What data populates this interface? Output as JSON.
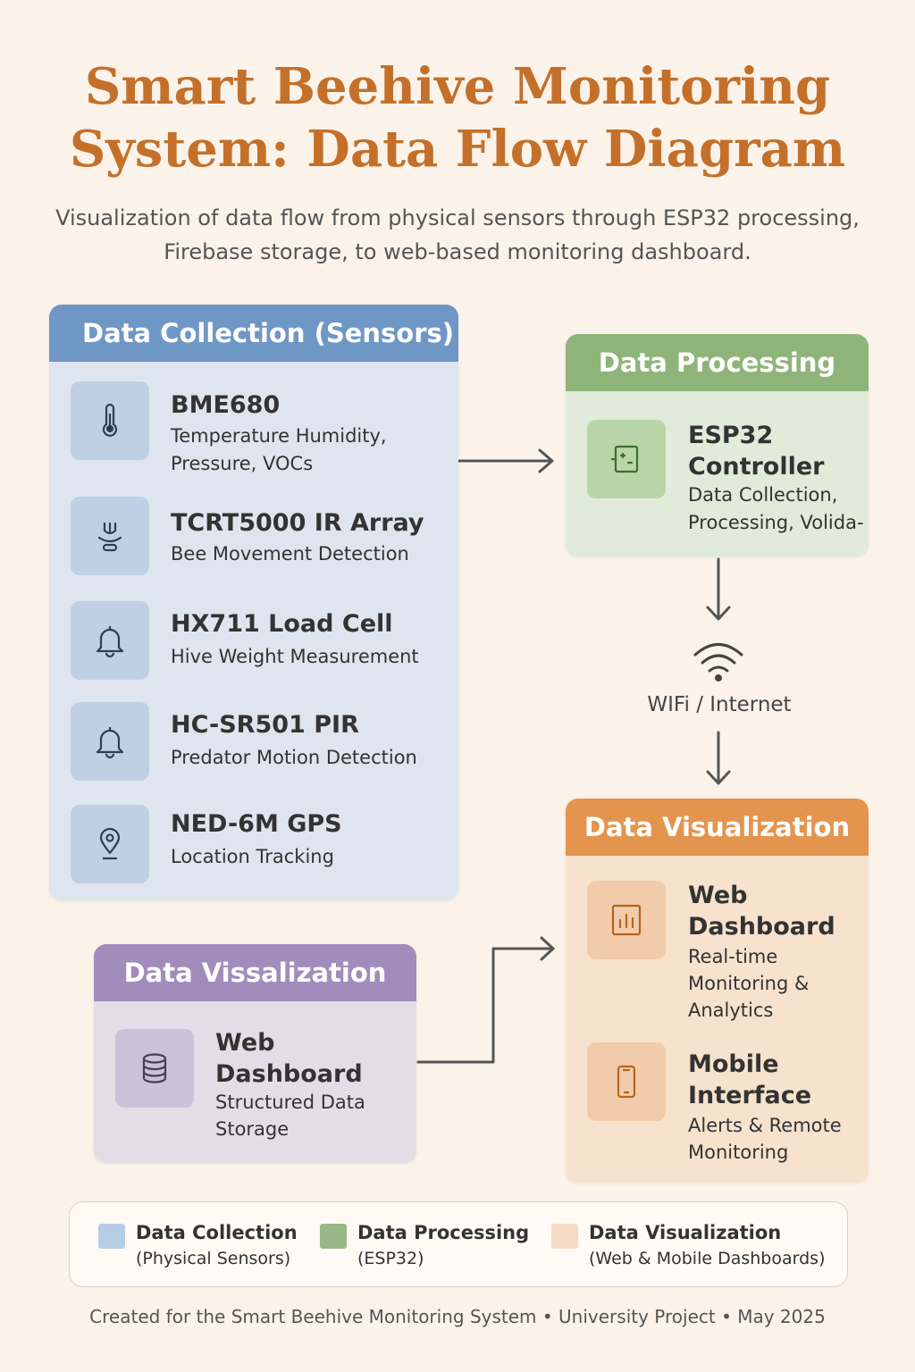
{
  "title_line1": "Smart Beehive Monitoring",
  "title_line2": "System: Data Flow Diagram",
  "subtitle": "Visualization of data flow from physical sensors through ESP32 processing, Firebase storage, to web-based monitoring dashboard.",
  "sensors": {
    "header": "Data Collection (Sensors)",
    "items": [
      {
        "name": "BME680",
        "desc": "Temperature Humidity, Pressure, VOCs",
        "icon": "thermometer-icon"
      },
      {
        "name": "TCRT5000 IR Array",
        "desc": "Bee Movement Detection",
        "icon": "ir-sensor-icon"
      },
      {
        "name": "HX711 Load Cell",
        "desc": "Hive Weight Measurement",
        "icon": "bell-icon"
      },
      {
        "name": "HC-SR501 PIR",
        "desc": "Predator Motion Detection",
        "icon": "bell-icon"
      },
      {
        "name": "NED-6M GPS",
        "desc": "Location Tracking",
        "icon": "location-pin-icon"
      }
    ]
  },
  "processing": {
    "header": "Data Processing",
    "item": {
      "name": "ESP32 Controller",
      "desc": "Data Collection, Processing, Volida-",
      "icon": "chip-icon"
    }
  },
  "network": {
    "label": "WIFi / Internet",
    "icon": "wifi-icon"
  },
  "visualization": {
    "header": "Data Visualization",
    "items": [
      {
        "name": "Web Dashboard",
        "desc": "Real-time Monitoring & Analytics",
        "icon": "bar-chart-icon"
      },
      {
        "name": "Mobile Interface",
        "desc": "Alerts & Remote Monitoring",
        "icon": "smartphone-icon"
      }
    ]
  },
  "storage": {
    "header": "Data Vissalization",
    "item": {
      "name": "Web Dashboard",
      "desc": "Structured Data Storage",
      "icon": "database-icon"
    }
  },
  "legend": [
    {
      "title": "Data Collection",
      "sub": "(Physical Sensors)",
      "color": "#b7cde6"
    },
    {
      "title": "Data Processing",
      "sub": "(ESP32)",
      "color": "#98b886"
    },
    {
      "title": "Data Visualization",
      "sub": "(Web & Mobile Dashboards)",
      "color": "#f6dcc2"
    }
  ],
  "footer": "Created for the Smart Beehive Monitoring System • University Project • May 2025",
  "colors": {
    "title": "#c4702a",
    "sensors_header": "#6f97c6",
    "processing_header": "#8fb47a",
    "visualization_header": "#e3954e",
    "storage_header": "#a18dbb"
  }
}
